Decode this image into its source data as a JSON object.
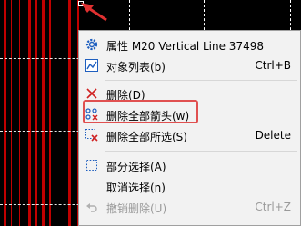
{
  "context_menu": {
    "items": [
      {
        "label": "属性 M20 Vertical Line 37498",
        "shortcut": "",
        "icon": "gear-icon"
      },
      {
        "label": "对象列表(b)",
        "shortcut": "Ctrl+B",
        "icon": "object-list-icon"
      },
      {
        "label": "删除(D)",
        "shortcut": "",
        "icon": "delete-x-icon"
      },
      {
        "label": "删除全部箭头(w)",
        "shortcut": "",
        "icon": "delete-arrows-icon"
      },
      {
        "label": "删除全部所选(S)",
        "shortcut": "Delete",
        "icon": "delete-selected-icon"
      },
      {
        "label": "部分选择(A)",
        "shortcut": "",
        "icon": "partial-select-icon"
      },
      {
        "label": "取消选择(n)",
        "shortcut": "",
        "icon": ""
      },
      {
        "label": "撤销删除(U)",
        "shortcut": "Ctrl+Z",
        "icon": "undo-icon",
        "disabled": true
      }
    ]
  },
  "colors": {
    "chart_background": "#000000",
    "vertical_line": "#c00000",
    "grid": "#ffffff",
    "menu_background": "#f2f2f2",
    "highlight_box": "#e05050",
    "icon_blue": "#1f5fbf",
    "icon_red": "#d02020"
  }
}
